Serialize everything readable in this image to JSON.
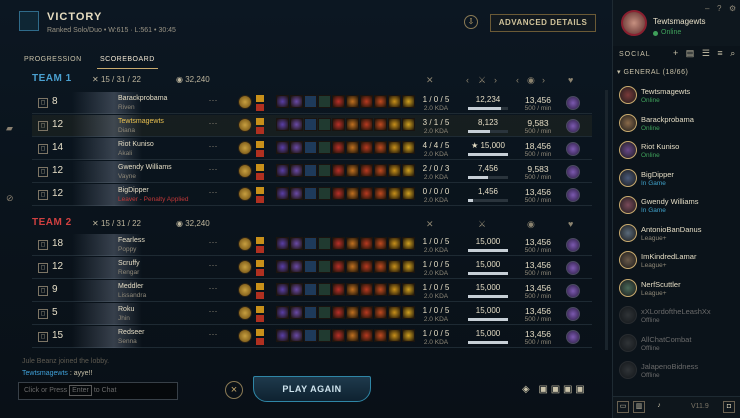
{
  "header": {
    "title": "VICTORY",
    "queue": "Ranked Solo/Duo",
    "record": "W:615 · L:561",
    "time": "30:45",
    "advanced_label": "ADVANCED DETAILS",
    "download_icon": "download-icon"
  },
  "tabs": [
    {
      "label": "PROGRESSION",
      "active": false
    },
    {
      "label": "SCOREBOARD",
      "active": true
    }
  ],
  "team1": {
    "name": "TEAM 1",
    "color": "#4aa0d0",
    "kda": "15 / 31 / 22",
    "gold": "32,240",
    "players": [
      {
        "level": "8",
        "name": "Barackprobama",
        "champ": "Riven",
        "kda": "1 / 0 / 5",
        "kda_ratio": "2.0 KDA",
        "damage": "12,234",
        "damage_frac": 0.82,
        "gold": "13,456",
        "gpm": "500 / min"
      },
      {
        "level": "12",
        "name": "Tewtsmagewts",
        "champ": "Diana",
        "kda": "3 / 1 / 5",
        "kda_ratio": "2.0 KDA",
        "damage": "8,123",
        "damage_frac": 0.55,
        "gold": "9,583",
        "gpm": "500 / min"
      },
      {
        "level": "14",
        "name": "Riot Kuniso",
        "champ": "Akali",
        "kda": "4 / 4 / 5",
        "kda_ratio": "2.0 KDA",
        "damage": "★ 15,000",
        "damage_frac": 1.0,
        "gold": "18,456",
        "gpm": "500 / min"
      },
      {
        "level": "12",
        "name": "Gwendy Williams",
        "champ": "Vayne",
        "kda": "2 / 0 / 3",
        "kda_ratio": "2.0 KDA",
        "damage": "7,456",
        "damage_frac": 0.5,
        "gold": "9,583",
        "gpm": "500 / min"
      },
      {
        "level": "12",
        "name": "BigDipper",
        "champ": "Leaver - Penalty Applied",
        "kda": "0 / 0 / 0",
        "kda_ratio": "2.0 KDA",
        "damage": "1,456",
        "damage_frac": 0.12,
        "gold": "13,456",
        "gpm": "500 / min"
      }
    ]
  },
  "team2": {
    "name": "TEAM 2",
    "color": "#d04040",
    "kda": "15 / 31 / 22",
    "gold": "32,240",
    "players": [
      {
        "level": "18",
        "name": "Fearless",
        "champ": "Poppy",
        "kda": "1 / 0 / 5",
        "kda_ratio": "2.0 KDA",
        "damage": "15,000",
        "damage_frac": 1.0,
        "gold": "13,456",
        "gpm": "500 / min"
      },
      {
        "level": "12",
        "name": "Scruffy",
        "champ": "Rengar",
        "kda": "1 / 0 / 5",
        "kda_ratio": "2.0 KDA",
        "damage": "15,000",
        "damage_frac": 1.0,
        "gold": "13,456",
        "gpm": "500 / min"
      },
      {
        "level": "9",
        "name": "Meddler",
        "champ": "Lissandra",
        "kda": "1 / 0 / 5",
        "kda_ratio": "2.0 KDA",
        "damage": "15,000",
        "damage_frac": 1.0,
        "gold": "13,456",
        "gpm": "500 / min"
      },
      {
        "level": "5",
        "name": "Roku",
        "champ": "Jhin",
        "kda": "1 / 0 / 5",
        "kda_ratio": "2.0 KDA",
        "damage": "15,000",
        "damage_frac": 1.0,
        "gold": "13,456",
        "gpm": "500 / min"
      },
      {
        "level": "15",
        "name": "Redseer",
        "champ": "Senna",
        "kda": "1 / 0 / 5",
        "kda_ratio": "2.0 KDA",
        "damage": "15,000",
        "damage_frac": 1.0,
        "gold": "13,456",
        "gpm": "500 / min"
      }
    ]
  },
  "chat": {
    "system": "Jule Beanz joined the lobby.",
    "author": "Tewtsmagewts",
    "message": " : ayye!!",
    "input_prefix": "Click or Press",
    "input_key": "Enter",
    "input_suffix": "to Chat"
  },
  "actions": {
    "play_again": "PLAY AGAIN",
    "close": "×"
  },
  "social": {
    "username": "Tewtsmagewts",
    "status": "Online",
    "section_label": "SOCIAL",
    "group_label": "GENERAL (18/66)",
    "version": "V11.9",
    "friends": [
      {
        "name": "Tewtsmagewts",
        "status": "Online",
        "state": "online"
      },
      {
        "name": "Barackprobama",
        "status": "Online",
        "state": "online"
      },
      {
        "name": "Riot Kuniso",
        "status": "Online",
        "state": "online"
      },
      {
        "name": "BigDipper",
        "status": "In Game",
        "state": "ingame"
      },
      {
        "name": "Gwendy Williams",
        "status": "In Game",
        "state": "ingame"
      },
      {
        "name": "AntonioBanDanus",
        "status": "League+",
        "state": "league"
      },
      {
        "name": "ImKindredLamar",
        "status": "League+",
        "state": "league"
      },
      {
        "name": "NerfScuttler",
        "status": "League+",
        "state": "league"
      },
      {
        "name": "xXLordoftheLeashXx",
        "status": "Offline",
        "state": "offline"
      },
      {
        "name": "AllChatCombat",
        "status": "Offline",
        "state": "offline"
      },
      {
        "name": "JalapenoBidness",
        "status": "Offline",
        "state": "offline"
      }
    ]
  },
  "colors": {
    "gold_accent": "#c8aa6e",
    "online": "#3fa05a",
    "ingame": "#3fa0c8",
    "league": "#8f8878",
    "offline": "#6a6a6a"
  }
}
